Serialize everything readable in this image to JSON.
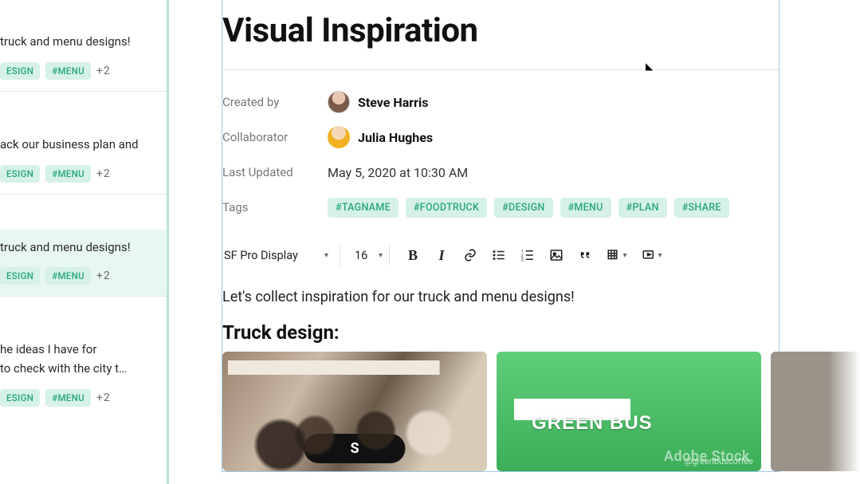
{
  "sidebar": {
    "cards": [
      {
        "snippet": "truck and menu designs!",
        "tags": [
          "ESIGN",
          "#MENU"
        ],
        "overflow": "+2",
        "selected": false
      },
      {
        "snippet": "ack our business plan and",
        "tags": [
          "ESIGN",
          "#MENU"
        ],
        "overflow": "+2",
        "selected": false
      },
      {
        "snippet": "truck and menu designs!",
        "tags": [
          "ESIGN",
          "#MENU"
        ],
        "overflow": "+2",
        "selected": true
      },
      {
        "snippet": "he ideas I have for",
        "snippet2": "to check with the city t…",
        "tags": [
          "ESIGN",
          "#MENU"
        ],
        "overflow": "+2",
        "selected": false
      }
    ]
  },
  "doc": {
    "title": "Visual Inspiration",
    "meta": {
      "createdByLabel": "Created by",
      "createdByName": "Steve Harris",
      "collaboratorLabel": "Collaborator",
      "collaboratorName": "Julia Hughes",
      "lastUpdatedLabel": "Last Updated",
      "lastUpdatedValue": "May 5, 2020 at 10:30 AM",
      "tagsLabel": "Tags",
      "tags": [
        "#TAGNAME",
        "#FOODTRUCK",
        "#DESIGN",
        "#MENU",
        "#PLAN",
        "#SHARE"
      ]
    },
    "toolbar": {
      "font": "SF Pro Display",
      "size": "16"
    },
    "body": {
      "intro": "Let's collect inspiration for our truck and menu designs!",
      "sectionHeading": "Truck design:"
    },
    "images": {
      "pillLetter": "S",
      "truckText": "GREEN BUS",
      "watermark": "Adobe Stock",
      "watermarkHandle": "@greenbuscoffee"
    }
  }
}
